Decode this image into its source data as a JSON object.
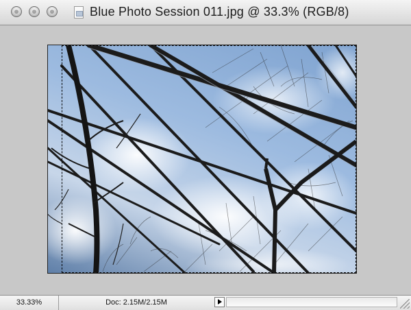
{
  "window": {
    "title": "Blue Photo Session 011.jpg @ 33.3% (RGB/8)"
  },
  "icons": {
    "close": "close-button-icon",
    "minimize": "minimize-button-icon",
    "zoom": "zoom-button-icon",
    "document": "jpeg-document-icon",
    "status_menu": "triangle-right-icon"
  },
  "status": {
    "zoom_level": "33.33%",
    "doc_size": "Doc: 2.15M/2.15M"
  },
  "colors": {
    "canvas_background": "#c8c8c8",
    "sky": "#8fb0db"
  }
}
